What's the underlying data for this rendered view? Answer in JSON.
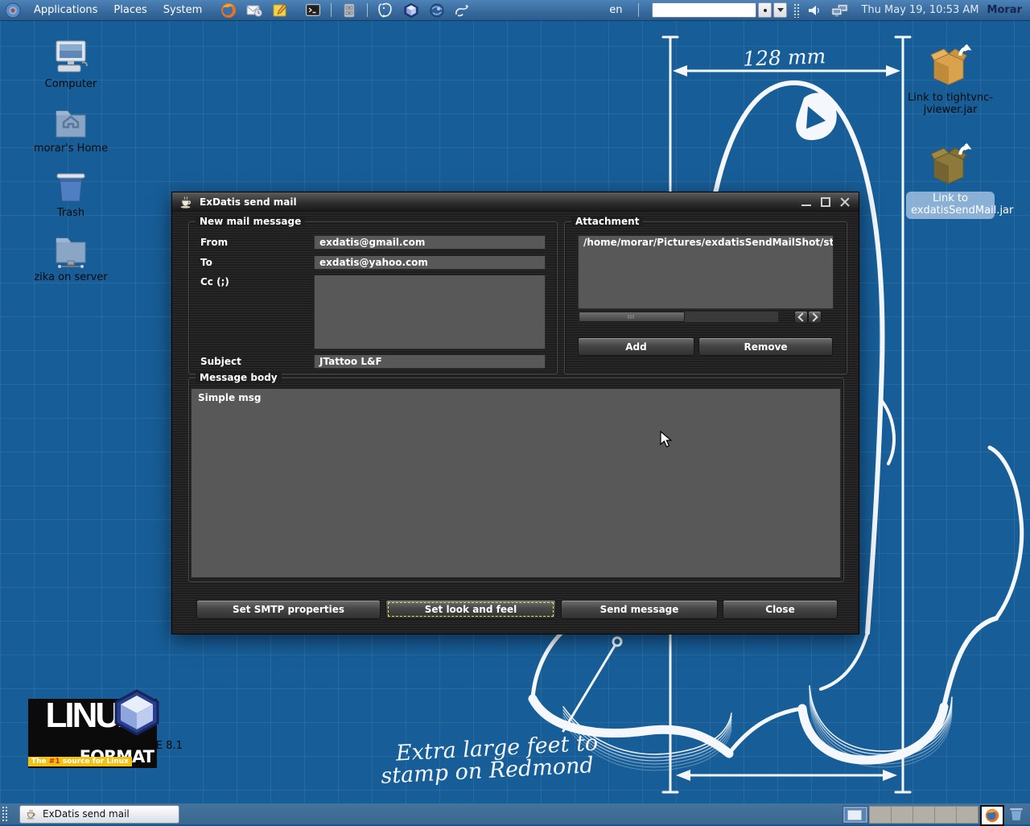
{
  "top_panel": {
    "menus": {
      "applications": "Applications",
      "places": "Places",
      "system": "System"
    },
    "keyboard_indicator": "en",
    "clock": "Thu May 19, 10:53 AM",
    "user": "Morar"
  },
  "desktop": {
    "icons": {
      "computer": "Computer",
      "home": "morar's Home",
      "trash": "Trash",
      "server": "zika on server",
      "tightvnc": "Link to tightvnc-jviewer.jar",
      "exdatis_link": "Link to exdatisSendMail.jar",
      "netbeans": "NetBeans IDE 8.1"
    },
    "annotations": {
      "width_label": "128 mm",
      "feet_line1": "Extra large feet to",
      "feet_line2": "stamp on Redmond"
    },
    "logo": {
      "line1": "LINUX",
      "line2": "FORMAT",
      "tag_pre": "The ",
      "tag_num": "#1",
      "tag_post": " source for Linux"
    }
  },
  "window": {
    "title": "ExDatis send mail",
    "new_mail": {
      "label": "New mail message",
      "from_label": "From",
      "from_value": "exdatis@gmail.com",
      "to_label": "To",
      "to_value": "exdatis@yahoo.com",
      "cc_label": "Cc (;)",
      "cc_value": "",
      "subject_label": "Subject",
      "subject_value": "JTattoo L&F"
    },
    "attachment": {
      "label": "Attachment",
      "item": "/home/morar/Pictures/exdatisSendMailShot/start",
      "add": "Add",
      "remove": "Remove"
    },
    "message": {
      "label": "Message body",
      "value": "Simple msg"
    },
    "buttons": {
      "smtp": "Set SMTP properties",
      "laf": "Set look and feel",
      "send": "Send message",
      "close": "Close"
    }
  },
  "taskbar": {
    "task_label": "ExDatis send mail"
  },
  "colors": {
    "desktop_blue": "#175d97",
    "panel_blue": "#37699c",
    "window_dark": "#1e1e1e",
    "field_gray": "#585858",
    "focus_yellow": "#e9e55f"
  }
}
